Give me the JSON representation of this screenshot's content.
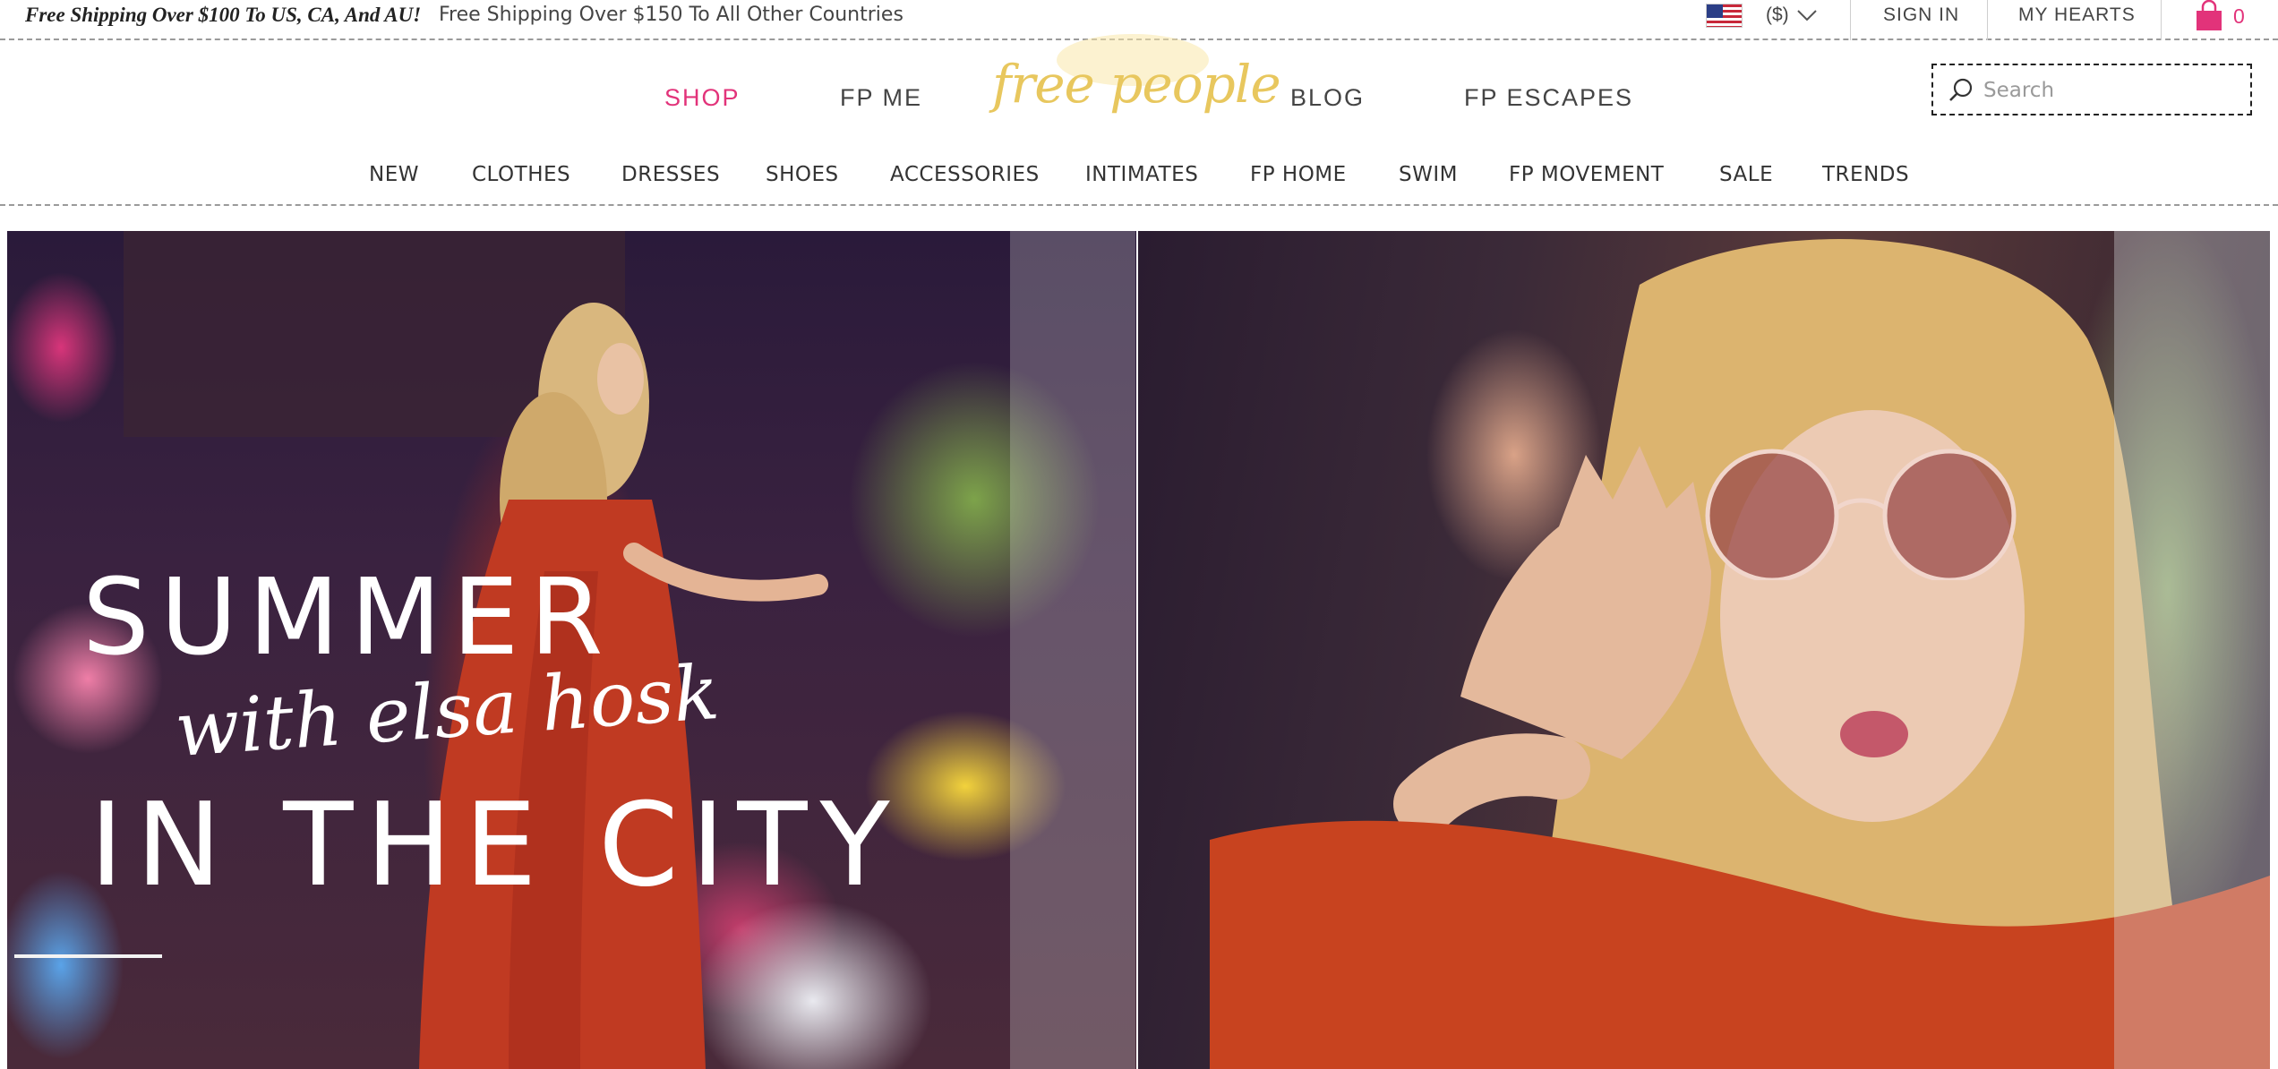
{
  "topbar": {
    "shipping_bold": "Free Shipping Over $100 To US, CA, And AU!",
    "shipping_regular": "Free Shipping Over $150 To All Other Countries",
    "currency": "($)",
    "sign_in": "SIGN IN",
    "my_hearts": "MY HEARTS",
    "bag_count": "0"
  },
  "main_nav": {
    "items": [
      "SHOP",
      "FP ME",
      "BLOG",
      "FP ESCAPES"
    ],
    "active": "SHOP",
    "logo_text": "free people"
  },
  "search": {
    "placeholder": "Search",
    "value": ""
  },
  "category_nav": {
    "items": [
      "NEW",
      "CLOTHES",
      "DRESSES",
      "SHOES",
      "ACCESSORIES",
      "INTIMATES",
      "FP HOME",
      "SWIM",
      "FP MOVEMENT",
      "SALE",
      "TRENDS"
    ]
  },
  "hero": {
    "line1": "SUMMER",
    "line2": "with elsa hosk",
    "line3": "IN THE CITY"
  },
  "icons": [
    "us-flag-icon",
    "chevron-down-icon",
    "shopping-bag-icon",
    "search-icon"
  ],
  "colors": {
    "accent": "#e2337a",
    "logo": "#e8c75e",
    "text": "#333333"
  }
}
